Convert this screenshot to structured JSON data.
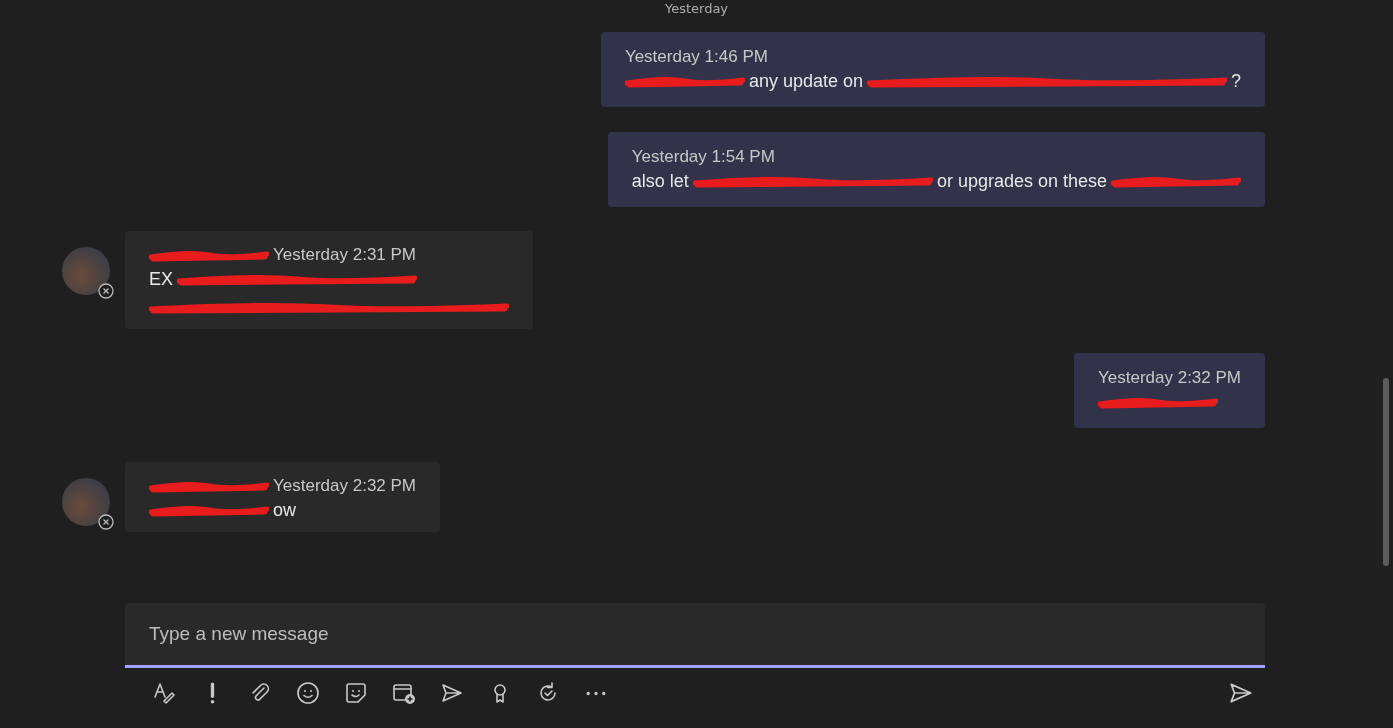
{
  "date_divider": "Yesterday",
  "messages": [
    {
      "kind": "sent",
      "time": "Yesterday 1:46 PM",
      "lines": [
        [
          {
            "kind": "redaction"
          },
          {
            "kind": "text",
            "text": "any update on"
          },
          {
            "kind": "redaction"
          },
          {
            "kind": "text",
            "text": "?"
          }
        ]
      ]
    },
    {
      "kind": "sent",
      "time": "Yesterday 1:54 PM",
      "lines": [
        [
          {
            "kind": "text",
            "text": "also let"
          },
          {
            "kind": "redaction"
          },
          {
            "kind": "text",
            "text": "or upgrades on these"
          },
          {
            "kind": "redaction"
          }
        ]
      ]
    },
    {
      "kind": "received",
      "time": "Yesterday 2:31 PM",
      "lines": [
        [
          {
            "kind": "redaction"
          }
        ],
        [
          {
            "kind": "text",
            "text": "EX"
          },
          {
            "kind": "redaction"
          }
        ],
        [
          {
            "kind": "redaction"
          }
        ]
      ]
    },
    {
      "kind": "sent",
      "time": "Yesterday 2:32 PM",
      "lines": [
        [
          {
            "kind": "redaction"
          }
        ]
      ]
    },
    {
      "kind": "received",
      "time": "Yesterday 2:32 PM",
      "lines": [
        [
          {
            "kind": "redaction"
          }
        ],
        [
          {
            "kind": "redaction"
          },
          {
            "kind": "text",
            "text": "ow"
          }
        ]
      ]
    }
  ],
  "composer": {
    "placeholder": "Type a new message"
  },
  "toolbar": [
    {
      "kind": "format"
    },
    {
      "kind": "important"
    },
    {
      "kind": "attach"
    },
    {
      "kind": "emoji"
    },
    {
      "kind": "sticker"
    },
    {
      "kind": "schedule"
    },
    {
      "kind": "forward"
    },
    {
      "kind": "praise"
    },
    {
      "kind": "loop"
    },
    {
      "kind": "more"
    }
  ]
}
